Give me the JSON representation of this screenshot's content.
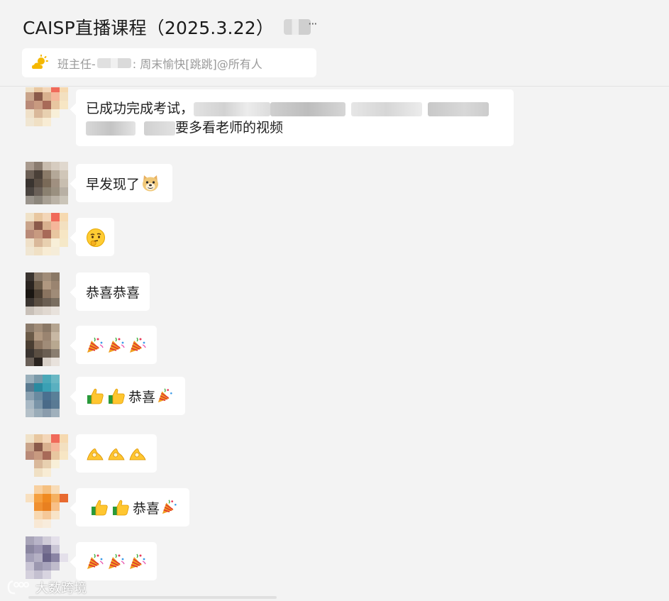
{
  "header": {
    "title": "CAISP直播课程（2025.3.22）",
    "more_label": "···"
  },
  "notice": {
    "prefix": "班主任-",
    "text": ": 周末愉快[跳跳]@所有人"
  },
  "messages": [
    {
      "text_line1": "已成功完成考试，",
      "text_line2_suffix": "要多看老师的视频"
    },
    {
      "text": "早发现了"
    },
    {
      "text": ""
    },
    {
      "text": "恭喜恭喜"
    },
    {
      "text": ""
    },
    {
      "text": "恭喜"
    },
    {
      "text": ""
    },
    {
      "text": "恭喜"
    },
    {
      "text": ""
    }
  ],
  "watermark": {
    "text": "大数跨境"
  },
  "colors": {
    "background": "#f3f3f3",
    "bubble": "#ffffff",
    "notice_icon": "#f5b800"
  }
}
